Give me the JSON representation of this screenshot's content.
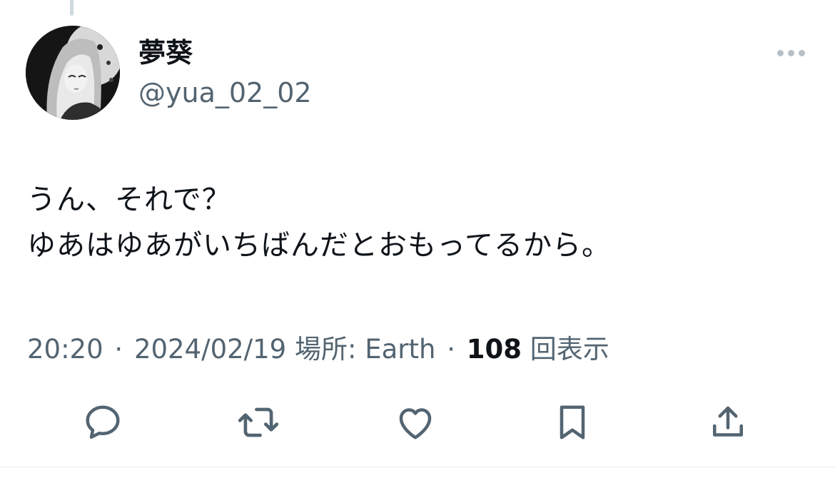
{
  "tweet": {
    "display_name": "夢葵",
    "handle": "@yua_02_02",
    "text_lines": [
      "うん、それで？",
      "ゆあはゆあがいちばんだとおもってるから。"
    ],
    "time": "20:20",
    "date": "2024/02/19",
    "location_label": "場所: Earth",
    "views_count": "108",
    "views_label": "回表示"
  },
  "icons": {
    "more": "more-dots-icon",
    "reply": "reply-icon",
    "retweet": "retweet-icon",
    "like": "heart-icon",
    "bookmark": "bookmark-icon",
    "share": "share-icon"
  },
  "colors": {
    "text_primary": "#0f1419",
    "text_secondary": "#536471",
    "icon_gray": "#536471",
    "divider": "#e6ecf0"
  }
}
